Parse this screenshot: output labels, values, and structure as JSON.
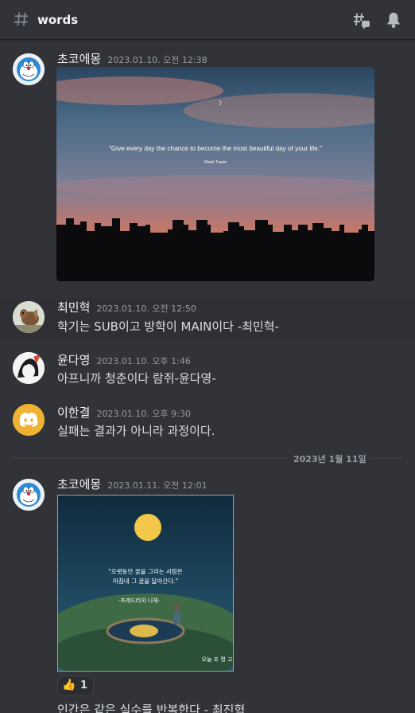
{
  "channel": {
    "name": "words"
  },
  "messages": [
    {
      "author": "초코에몽",
      "timestamp": "2023.01.10. 오전 12:38",
      "content": "",
      "image_quote": "\"Give every day the chance to become the most beautiful day of your life.\"",
      "image_attribution": "Mark Twain"
    },
    {
      "author": "최민혁",
      "timestamp": "2023.01.10. 오전 12:50",
      "content": "학기는 SUB이고 방학이 MAIN이다 -최민혁-"
    },
    {
      "author": "윤다영",
      "timestamp": "2023.01.10. 오후 1:46",
      "content": "아프니까 청춘이다 람쥐-윤다영-"
    },
    {
      "author": "이한결",
      "timestamp": "2023.01.10. 오후 9:30",
      "content": "실패는 결과가 아니라 과정이다."
    },
    {
      "author": "초코에몽",
      "timestamp": "2023.01.11. 오전 12:01",
      "content": "",
      "image_quote_line1": "\"오랫동안 꿈을 그리는 사람은",
      "image_quote_line2": "마침내 그 꿈을 닮아간다.\"",
      "image_attribution": "-프레드리히 니체-",
      "image_logo": "오늘 조 명 고",
      "reaction": {
        "emoji": "👍",
        "count": "1"
      }
    },
    {
      "partial_content": "인간은 같은 실수를 반복한다 - 최진혁"
    }
  ],
  "date_divider": "2023년 1월 11일",
  "colors": {
    "background": "#313338",
    "header": "#313338",
    "text": "#dbdee1",
    "muted": "#949ba4",
    "discord_avatar": "#f0b232"
  }
}
